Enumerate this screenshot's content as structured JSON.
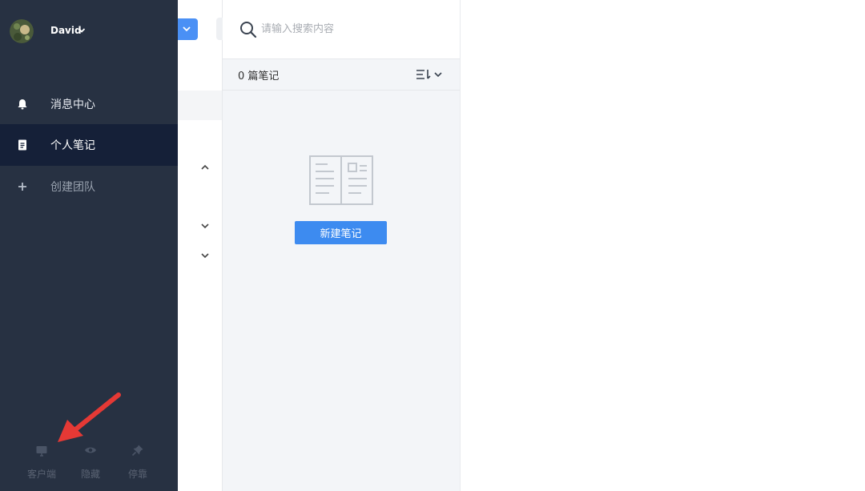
{
  "user": {
    "name": "David"
  },
  "sidebar": {
    "items": [
      {
        "label": "消息中心",
        "icon": "bell-icon",
        "active": false
      },
      {
        "label": "个人笔记",
        "icon": "note-icon",
        "active": true
      },
      {
        "label": "创建团队",
        "icon": "plus-icon",
        "active": false
      }
    ],
    "footer": [
      {
        "label": "客户端",
        "icon": "monitor-icon"
      },
      {
        "label": "隐藏",
        "icon": "eye-icon"
      },
      {
        "label": "停靠",
        "icon": "pin-icon"
      }
    ]
  },
  "search": {
    "placeholder": "请输入搜索内容"
  },
  "notes_list": {
    "count_label": "0 篇笔记",
    "sort_icon": "sort-icon",
    "empty_state_icon": "open-book-icon",
    "new_note_label": "新建笔记"
  },
  "colors": {
    "sidebar_bg": "#273142",
    "sidebar_active_bg": "#152038",
    "accent": "#3d8bf0",
    "list_bg": "#f3f5f8",
    "annotation_arrow": "#e53935"
  }
}
